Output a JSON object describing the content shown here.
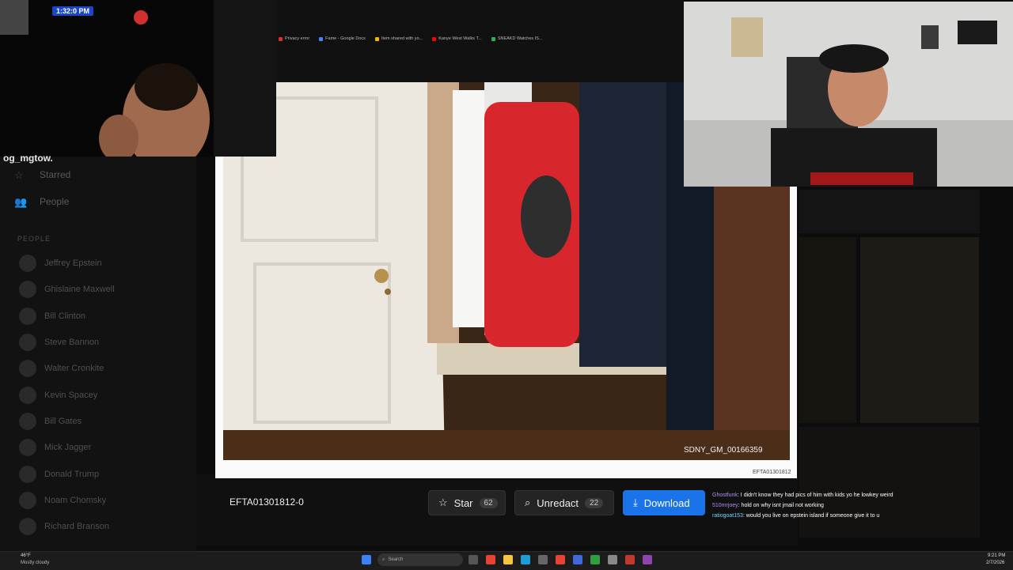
{
  "browser": {
    "bookmarks": [
      {
        "label": "Privacy error",
        "icon": "warning-icon",
        "color": "#d93025"
      },
      {
        "label": "Fame - Google Docs",
        "icon": "docs-icon",
        "color": "#4285f4"
      },
      {
        "label": "Item shared with yo...",
        "icon": "drive-icon",
        "color": "#f4b400"
      },
      {
        "label": "Kanye West Walks T...",
        "icon": "youtube-icon",
        "color": "#ff0000"
      },
      {
        "label": "SNEAKD Watches IS...",
        "icon": "spotify-icon",
        "color": "#1db954"
      }
    ]
  },
  "sidebar": {
    "nav": [
      {
        "label": "Starred",
        "icon": "star-icon"
      },
      {
        "label": "People",
        "icon": "people-icon"
      }
    ],
    "people_heading": "PEOPLE",
    "people": [
      "Jeffrey Epstein",
      "Ghislaine Maxwell",
      "Bill Clinton",
      "Steve Bannon",
      "Walter Cronkite",
      "Kevin Spacey",
      "Bill Gates",
      "Mick Jagger",
      "Donald Trump",
      "Noam Chomsky",
      "Richard Branson"
    ]
  },
  "viewer": {
    "photo_caption": "SDNY_GM_00166359",
    "card_code": "EFTA01301812",
    "file_id": "EFTA01301812-0",
    "star": {
      "label": "Star",
      "count": "62",
      "icon": "star-icon"
    },
    "unredact": {
      "label": "Unredact",
      "count": "22",
      "icon": "search-icon"
    },
    "download": {
      "label": "Download",
      "icon": "download-icon",
      "color": "#1a73e8"
    }
  },
  "stream": {
    "streamer_name": "og_mgtow.",
    "timer": "1:32:0 PM"
  },
  "chat": [
    {
      "user": "Ghostfunk",
      "message": ": I didn't know they had pics of him with kids yo he lowkey weird"
    },
    {
      "user": "510mrjoey",
      "message": ": hold on why isnt jmail not working"
    },
    {
      "user": "ratiogoat153",
      "message": ": would you live on epstein island if someone give it to u"
    }
  ],
  "taskbar": {
    "weather_temp": "46°F",
    "weather_desc": "Mostly cloudy",
    "search_placeholder": "Search",
    "time": "9:21 PM",
    "date": "2/7/2026"
  }
}
